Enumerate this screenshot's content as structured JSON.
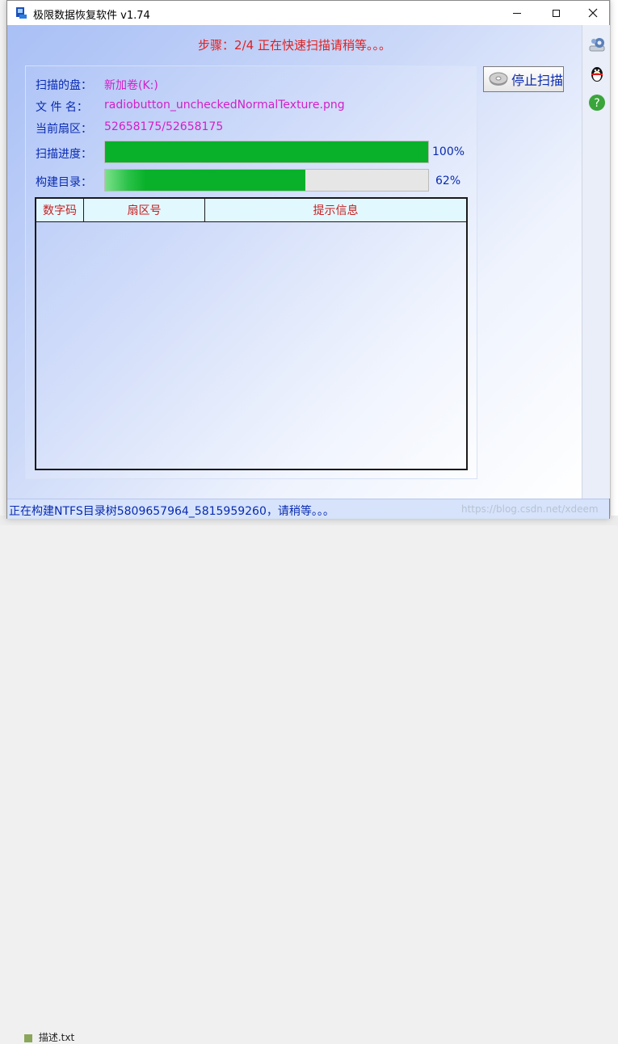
{
  "window": {
    "title": "极限数据恢复软件 v1.74"
  },
  "step_text": "步骤：2/4 正在快速扫描请稍等。。。",
  "fields": {
    "disk_label": "扫描的盘：",
    "disk_value": "新加卷(K:)",
    "file_label": "文 件 名：",
    "file_value": "radiobutton_uncheckedNormalTexture.png",
    "sector_label": "当前扇区：",
    "sector_value": "52658175/52658175"
  },
  "progress": {
    "scan_label": "扫描进度：",
    "scan_value": 1.0,
    "scan_percent_text": "100%",
    "build_label": "构建目录：",
    "build_value": 0.62,
    "build_percent_text": "62%"
  },
  "buttons": {
    "stop_scan": "停止扫描"
  },
  "table": {
    "columns": [
      "数字码",
      "扇区号",
      "提示信息"
    ],
    "rows": []
  },
  "sidebar": {
    "icons": [
      "gear-icon",
      "qq-penguin-icon",
      "help-icon"
    ]
  },
  "status": {
    "text": "正在构建NTFS目录树5809657964_5815959260，请稍等。。。",
    "watermark": "https://blog.csdn.net/xdeem"
  },
  "background": {
    "file_name": "描述.txt"
  },
  "colors": {
    "accent_blue": "#0a2bb0",
    "value_magenta": "#d21fc9",
    "step_red": "#e02020",
    "progress_green": "#09b12a",
    "header_red": "#c62020"
  }
}
